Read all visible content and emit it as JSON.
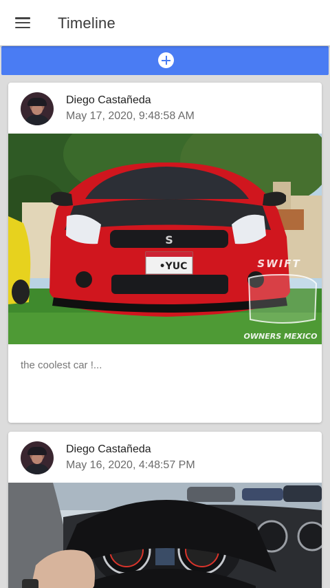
{
  "appbar": {
    "title": "Timeline",
    "menu_icon": "menu-icon"
  },
  "add_bar": {
    "icon": "plus-circle-icon",
    "color": "#4a7cf3"
  },
  "posts": [
    {
      "author": "Diego Castañeda",
      "date": "May 17, 2020, 9:48:58 AM",
      "image_desc": "red-car-photo",
      "caption": "the coolest car !...",
      "plate": "•YUC",
      "watermark_line1": "SWIFT",
      "watermark_line2": "OWNERS MEXICO"
    },
    {
      "author": "Diego Castañeda",
      "date": "May 16, 2020, 4:48:57 PM",
      "image_desc": "steering-wheel-photo"
    }
  ]
}
